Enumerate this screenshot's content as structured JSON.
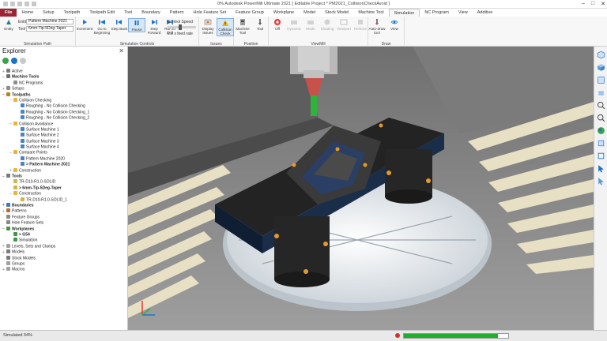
{
  "titlebar": {
    "title": "0% Autodesk PowerMill Ultimate 2021   [ Editable Project * PM2021_CollisionCheckAvoid ]",
    "min": "–",
    "max": "□",
    "close": "✕"
  },
  "tabs": [
    "File",
    "Home",
    "Setup",
    "Toolpath",
    "Toolpath Edit",
    "Tool",
    "Boundary",
    "Pattern",
    "Hole Feature Set",
    "Feature Group",
    "Workplane",
    "Model",
    "Stock Model",
    "Machine Tool",
    "Simulation",
    "NC Program",
    "View",
    "Additive"
  ],
  "active_tab": "Simulation",
  "ribbon": {
    "sim_path": {
      "group_label": "Simulation Path",
      "entity_label": "Entity",
      "entity_button": "Entity",
      "entity_value": "Pattern Machine 2021",
      "tool_label": "Tool",
      "tool_value": "6mm-Tip-5Deg-Taper"
    },
    "sim_controls": {
      "group_label": "Simulation Controls",
      "buttons": [
        "Increment",
        "Go to Beginning",
        "Step Back",
        "Pause",
        "Step Forward",
        "Run to End"
      ],
      "speed_label": "Control Speed",
      "feedrate": "2.0 x feed rate"
    },
    "issues": {
      "group_label": "Issues",
      "buttons": [
        "Display Issues",
        "Collision Check"
      ]
    },
    "position": {
      "group_label": "Position",
      "buttons": [
        "Machine Tool",
        "Tool"
      ]
    },
    "viewmill": {
      "group_label": "ViewMill",
      "buttons": [
        "Off",
        "Dynamic",
        "Mode",
        "Shading",
        "Viewport",
        "Restore"
      ]
    },
    "draw": {
      "group_label": "Draw",
      "buttons": [
        "Auto-draw tool",
        "View"
      ]
    }
  },
  "explorer": {
    "title": "Explorer",
    "close": "✕",
    "tree": [
      {
        "label": "Active",
        "indent": 0,
        "toggle": "+",
        "color": "#7a7a7a"
      },
      {
        "label": "Machine Tools",
        "indent": 0,
        "toggle": "−",
        "color": "#6d6d6d",
        "bold": true
      },
      {
        "label": "NC Programs",
        "indent": 1,
        "toggle": "",
        "color": "#8d8d8d"
      },
      {
        "label": "Setups",
        "indent": 0,
        "toggle": "+",
        "color": "#8d8d8d"
      },
      {
        "label": "Toolpaths",
        "indent": 0,
        "toggle": "−",
        "color": "#b0851a",
        "bold": true
      },
      {
        "label": "Collision Checking",
        "indent": 1,
        "toggle": "−",
        "color": "#e7b53c"
      },
      {
        "label": "Roughing - No Collision Checking",
        "indent": 2,
        "toggle": "",
        "color": "#4c83c4"
      },
      {
        "label": "Roughing - No Collision Checking_1",
        "indent": 2,
        "toggle": "",
        "color": "#4c83c4"
      },
      {
        "label": "Roughing - No Collision Checking_2",
        "indent": 2,
        "toggle": "",
        "color": "#4c83c4"
      },
      {
        "label": "Collision Avoidance",
        "indent": 1,
        "toggle": "−",
        "color": "#e7b53c"
      },
      {
        "label": "Surface Machine 1",
        "indent": 2,
        "toggle": "",
        "color": "#4c83c4"
      },
      {
        "label": "Surface Machine 2",
        "indent": 2,
        "toggle": "",
        "color": "#4c83c4"
      },
      {
        "label": "Surface Machine 3",
        "indent": 2,
        "toggle": "",
        "color": "#4c83c4"
      },
      {
        "label": "Surface Machine 4",
        "indent": 2,
        "toggle": "",
        "color": "#4c83c4"
      },
      {
        "label": "Compare Points",
        "indent": 1,
        "toggle": "−",
        "color": "#e7b53c"
      },
      {
        "label": "Pattern Machine 2020",
        "indent": 2,
        "toggle": "",
        "color": "#4c83c4"
      },
      {
        "label": "> Pattern Machine 2021",
        "indent": 2,
        "toggle": "",
        "color": "#4c83c4",
        "bold": true
      },
      {
        "label": "Construction",
        "indent": 1,
        "toggle": "+",
        "color": "#e7b53c"
      },
      {
        "label": "Tools",
        "indent": 0,
        "toggle": "−",
        "color": "#7a7a7a",
        "bold": true
      },
      {
        "label": "TR-D10-R1.0-SOLID",
        "indent": 1,
        "toggle": "",
        "color": "#d5b446"
      },
      {
        "label": "> 6mm-Tip-5Deg-Taper",
        "indent": 1,
        "toggle": "",
        "color": "#d5b446",
        "bold": true
      },
      {
        "label": "Construction",
        "indent": 1,
        "toggle": "−",
        "color": "#e7b53c"
      },
      {
        "label": "TR-D10-R1.0-SOLID_1",
        "indent": 2,
        "toggle": "",
        "color": "#d5b446"
      },
      {
        "label": "Boundaries",
        "indent": 0,
        "toggle": "+",
        "color": "#3a7bbf",
        "bold": true
      },
      {
        "label": "Patterns",
        "indent": 0,
        "toggle": "+",
        "color": "#c26a2a"
      },
      {
        "label": "Feature Groups",
        "indent": 0,
        "toggle": "",
        "color": "#8a8a8a"
      },
      {
        "label": "Hole Feature Sets",
        "indent": 0,
        "toggle": "",
        "color": "#8a8a8a"
      },
      {
        "label": "Workplanes",
        "indent": 0,
        "toggle": "−",
        "color": "#3d9a3d",
        "bold": true
      },
      {
        "label": "> G54",
        "indent": 1,
        "toggle": "",
        "color": "#3d9a3d",
        "bold": true
      },
      {
        "label": "Simulation",
        "indent": 1,
        "toggle": "",
        "color": "#3d9a3d"
      },
      {
        "label": "Levels, Sets and Clamps",
        "indent": 0,
        "toggle": "+",
        "color": "#a0a0a0"
      },
      {
        "label": "Models",
        "indent": 0,
        "toggle": "+",
        "color": "#7a7a7a"
      },
      {
        "label": "Stock Models",
        "indent": 0,
        "toggle": "",
        "color": "#7a7a7a"
      },
      {
        "label": "Groups",
        "indent": 0,
        "toggle": "",
        "color": "#a0a0a0"
      },
      {
        "label": "Macros",
        "indent": 0,
        "toggle": "+",
        "color": "#a0a0a0"
      }
    ]
  },
  "status": {
    "text": "Simulated 54%",
    "progress": 0.9
  },
  "colors": {
    "accent": "#9b2335",
    "brand_blue": "#1b74c7",
    "progress": "#1fae2e"
  }
}
